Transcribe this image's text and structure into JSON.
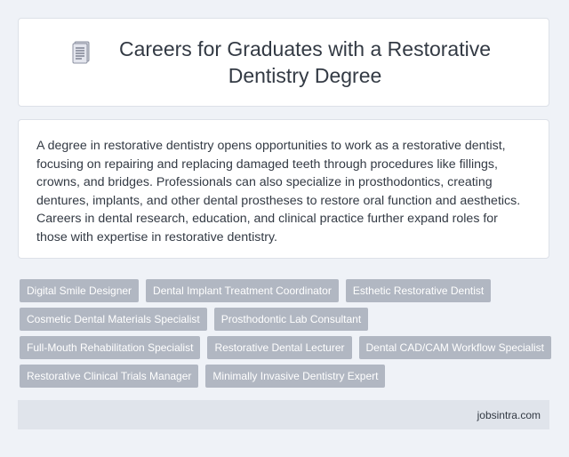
{
  "header": {
    "title": "Careers for Graduates with a Restorative Dentistry Degree",
    "icon": "document-icon"
  },
  "description": "A degree in restorative dentistry opens opportunities to work as a restorative dentist, focusing on repairing and replacing damaged teeth through procedures like fillings, crowns, and bridges. Professionals can also specialize in prosthodontics, creating dentures, implants, and other dental prostheses to restore oral function and aesthetics. Careers in dental research, education, and clinical practice further expand roles for those with expertise in restorative dentistry.",
  "tags": [
    [
      "Digital Smile Designer",
      "Dental Implant Treatment Coordinator",
      "Esthetic Restorative Dentist"
    ],
    [
      "Cosmetic Dental Materials Specialist",
      "Prosthodontic Lab Consultant"
    ],
    [
      "Full-Mouth Rehabilitation Specialist",
      "Restorative Dental Lecturer",
      "Dental CAD/CAM Workflow Specialist"
    ],
    [
      "Restorative Clinical Trials Manager",
      "Minimally Invasive Dentistry Expert"
    ]
  ],
  "footer": {
    "site": "jobsintra.com"
  },
  "colors": {
    "background": "#eff2f7",
    "tag": "#b1b7c2",
    "footer": "#e0e4eb",
    "text": "#333a44"
  }
}
